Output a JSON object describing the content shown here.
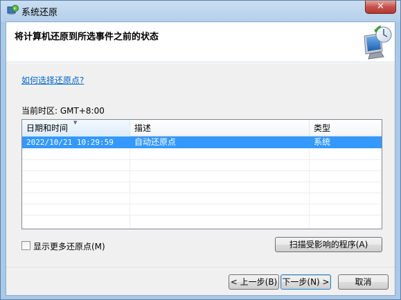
{
  "window": {
    "title": "系统还原",
    "close_label": "✕"
  },
  "header": {
    "title": "将计算机还原到所选事件之前的状态"
  },
  "help_link": "如何选择还原点?",
  "timezone_label": "当前时区: GMT+8:00",
  "table": {
    "columns": [
      "日期和时间",
      "描述",
      "类型"
    ],
    "sorted_column": "日期和时间",
    "rows": [
      {
        "date": "2022/10/21 10:29:59",
        "description": "自动还原点",
        "type": "系统",
        "selected": true
      }
    ]
  },
  "show_more": {
    "label": "显示更多还原点(M)",
    "checked": false
  },
  "buttons": {
    "scan": "扫描受影响的程序(A)",
    "back": "< 上一步(B)",
    "next": "下一步(N) >",
    "cancel": "取消"
  },
  "colors": {
    "selection": "#3399ff",
    "link": "#0066cc",
    "frame": "#a9c9e8"
  }
}
